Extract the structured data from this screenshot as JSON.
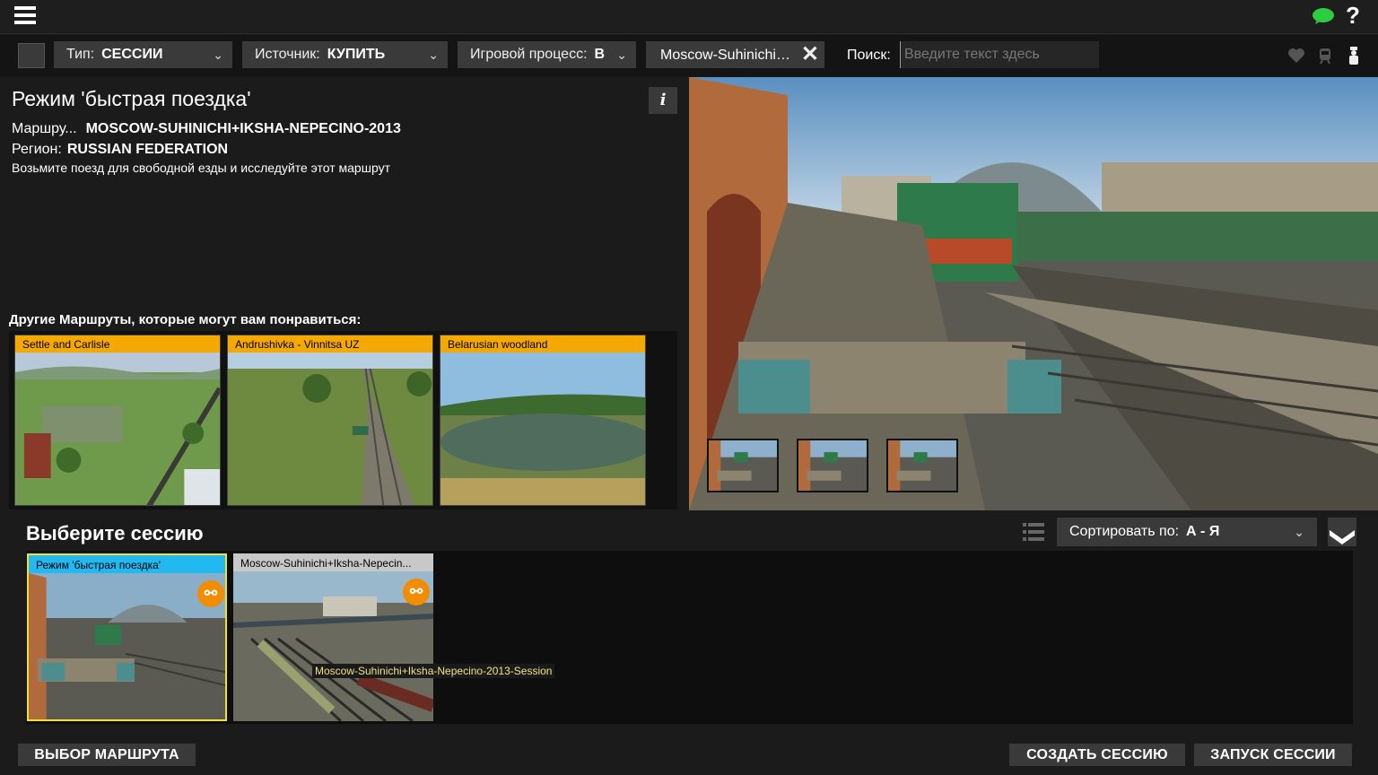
{
  "topbar": {
    "menu_icon": "hamburger-menu-icon",
    "chat_icon": "chat-bubble-icon",
    "help_label": "?"
  },
  "filters": {
    "type_label": "Тип:",
    "type_value": "СЕССИИ",
    "source_label": "Источник:",
    "source_value": "КУПИТЬ",
    "gameplay_label": "Игровой процесс:",
    "gameplay_value": "В",
    "route_filter": "Moscow-Suhinichi…",
    "search_label": "Поиск:",
    "search_placeholder": "Введите текст здесь",
    "chevron": "⌄",
    "close": "✕"
  },
  "info": {
    "title": "Режим 'быстрая поездка'",
    "info_button": "i",
    "route_label": "Маршру...",
    "route_value": "MOSCOW-SUHINICHI+IKSHA-NEPECINO-2013",
    "region_label": "Регион:",
    "region_value": "RUSSIAN FEDERATION",
    "description": "Возьмите поезд для свободной езды и исследуйте этот маршрут"
  },
  "other_routes": {
    "title": "Другие Маршруты, которые могут вам понравиться:",
    "items": [
      {
        "label": "Settle and Carlisle"
      },
      {
        "label": "Andrushivka - Vinnitsa UZ"
      },
      {
        "label": "Belarusian woodland"
      }
    ]
  },
  "sessions": {
    "title": "Выберите сессию",
    "sort_label": "Сортировать по:",
    "sort_value": "А - Я",
    "items": [
      {
        "label": "Режим 'быстрая поездка'",
        "caption_color": "#22b8f0"
      },
      {
        "label": "Moscow-Suhinichi+Iksha-Nepecin...",
        "caption_color": "#c8c8c8"
      }
    ],
    "tooltip": "Moscow-Suhinichi+Iksha-Nepecino-2013-Session"
  },
  "buttons": {
    "route_select": "ВЫБОР МАРШРУТА",
    "create_session": "СОЗДАТЬ СЕССИЮ",
    "start_session": "ЗАПУСК СЕССИИ"
  },
  "colors": {
    "accent_orange": "#f5a800",
    "selected_border": "#f3e12a",
    "chat_green": "#2ecc40"
  }
}
